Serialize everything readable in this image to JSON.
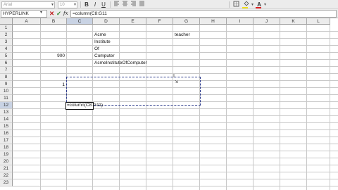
{
  "toolbar": {
    "font_name": "Arial",
    "font_size": "10",
    "bold": "B",
    "italic": "I",
    "underline": "U",
    "font_color_glyph": "A",
    "highlight_color": "#f0e020",
    "font_color": "#e02020",
    "icons": [
      "align-left-icon",
      "align-center-icon",
      "align-right-icon",
      "justify-icon",
      "merge-icon",
      "borders-icon",
      "fill-color-icon",
      "font-color-icon"
    ]
  },
  "formula_bar": {
    "name_box": "HYPERLINK",
    "cancel": "✕",
    "accept": "✓",
    "fx": "fx",
    "formula": "=column(C8:G11"
  },
  "columns": [
    "A",
    "B",
    "C",
    "D",
    "E",
    "F",
    "G",
    "H",
    "I",
    "J",
    "K",
    "L"
  ],
  "selected_column": "C",
  "rows": [
    "1",
    "2",
    "3",
    "4",
    "5",
    "6",
    "7",
    "8",
    "9",
    "10",
    "11",
    "12",
    "13",
    "14",
    "15",
    "16",
    "17",
    "18",
    "19",
    "20",
    "21",
    "22",
    "23"
  ],
  "selected_row": "12",
  "cells": {
    "D2": "Acme",
    "G2": "teacher",
    "D3": "Institute",
    "D4": "Of",
    "B5": "900",
    "D5": "Computer",
    "D6": "AcmeInstituteOfComputer",
    "B9": "1",
    "C12": "=column(C8:G11)"
  }
}
